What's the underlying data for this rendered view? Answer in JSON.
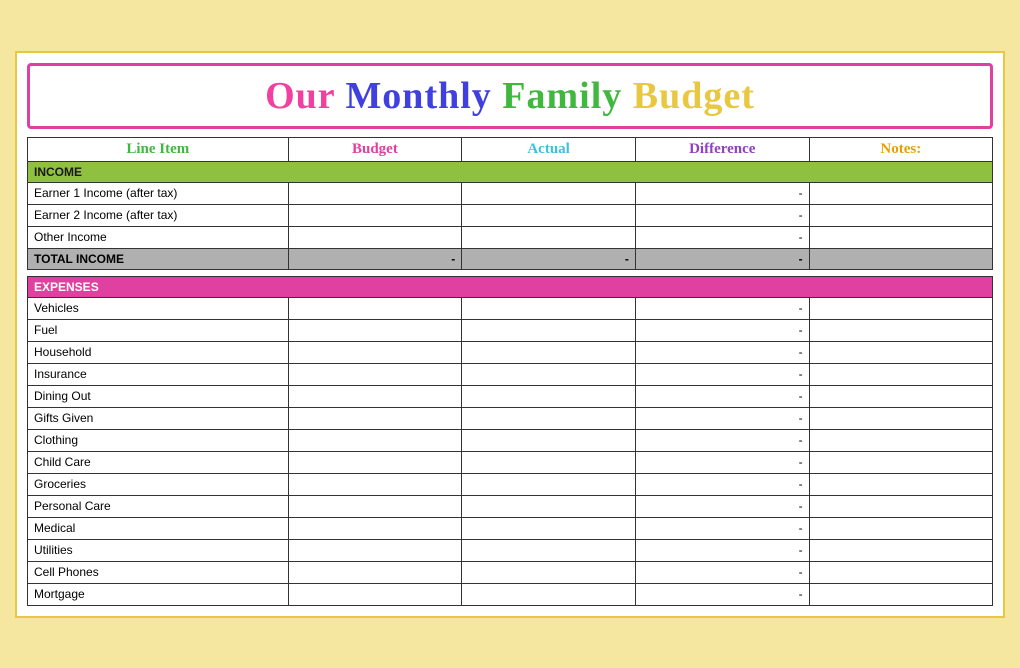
{
  "title": {
    "our": "Our ",
    "monthly": "Monthly ",
    "family": "Family ",
    "budget": "Budget"
  },
  "headers": {
    "line_item": "Line Item",
    "budget": "Budget",
    "actual": "Actual",
    "difference": "Difference",
    "notes": "Notes:"
  },
  "income": {
    "section_label": "Income",
    "rows": [
      {
        "label": "Earner 1 Income (after tax)",
        "budget": "",
        "actual": "",
        "difference": "-",
        "notes": ""
      },
      {
        "label": "Earner 2 Income (after tax)",
        "budget": "",
        "actual": "",
        "difference": "-",
        "notes": ""
      },
      {
        "label": "Other Income",
        "budget": "",
        "actual": "",
        "difference": "-",
        "notes": ""
      }
    ],
    "total_label": "Total Income",
    "total_budget": "-",
    "total_actual": "-",
    "total_difference": "-"
  },
  "expenses": {
    "section_label": "Expenses",
    "rows": [
      {
        "label": "Vehicles",
        "budget": "",
        "actual": "",
        "difference": "-",
        "notes": ""
      },
      {
        "label": "Fuel",
        "budget": "",
        "actual": "",
        "difference": "-",
        "notes": ""
      },
      {
        "label": "Household",
        "budget": "",
        "actual": "",
        "difference": "-",
        "notes": ""
      },
      {
        "label": "Insurance",
        "budget": "",
        "actual": "",
        "difference": "-",
        "notes": ""
      },
      {
        "label": "Dining Out",
        "budget": "",
        "actual": "",
        "difference": "-",
        "notes": ""
      },
      {
        "label": "Gifts Given",
        "budget": "",
        "actual": "",
        "difference": "-",
        "notes": ""
      },
      {
        "label": "Clothing",
        "budget": "",
        "actual": "",
        "difference": "-",
        "notes": ""
      },
      {
        "label": "Child Care",
        "budget": "",
        "actual": "",
        "difference": "-",
        "notes": ""
      },
      {
        "label": "Groceries",
        "budget": "",
        "actual": "",
        "difference": "-",
        "notes": ""
      },
      {
        "label": "Personal Care",
        "budget": "",
        "actual": "",
        "difference": "-",
        "notes": ""
      },
      {
        "label": "Medical",
        "budget": "",
        "actual": "",
        "difference": "-",
        "notes": ""
      },
      {
        "label": "Utilities",
        "budget": "",
        "actual": "",
        "difference": "-",
        "notes": ""
      },
      {
        "label": "Cell Phones",
        "budget": "",
        "actual": "",
        "difference": "-",
        "notes": ""
      },
      {
        "label": "Mortgage",
        "budget": "",
        "actual": "",
        "difference": "-",
        "notes": ""
      }
    ]
  }
}
